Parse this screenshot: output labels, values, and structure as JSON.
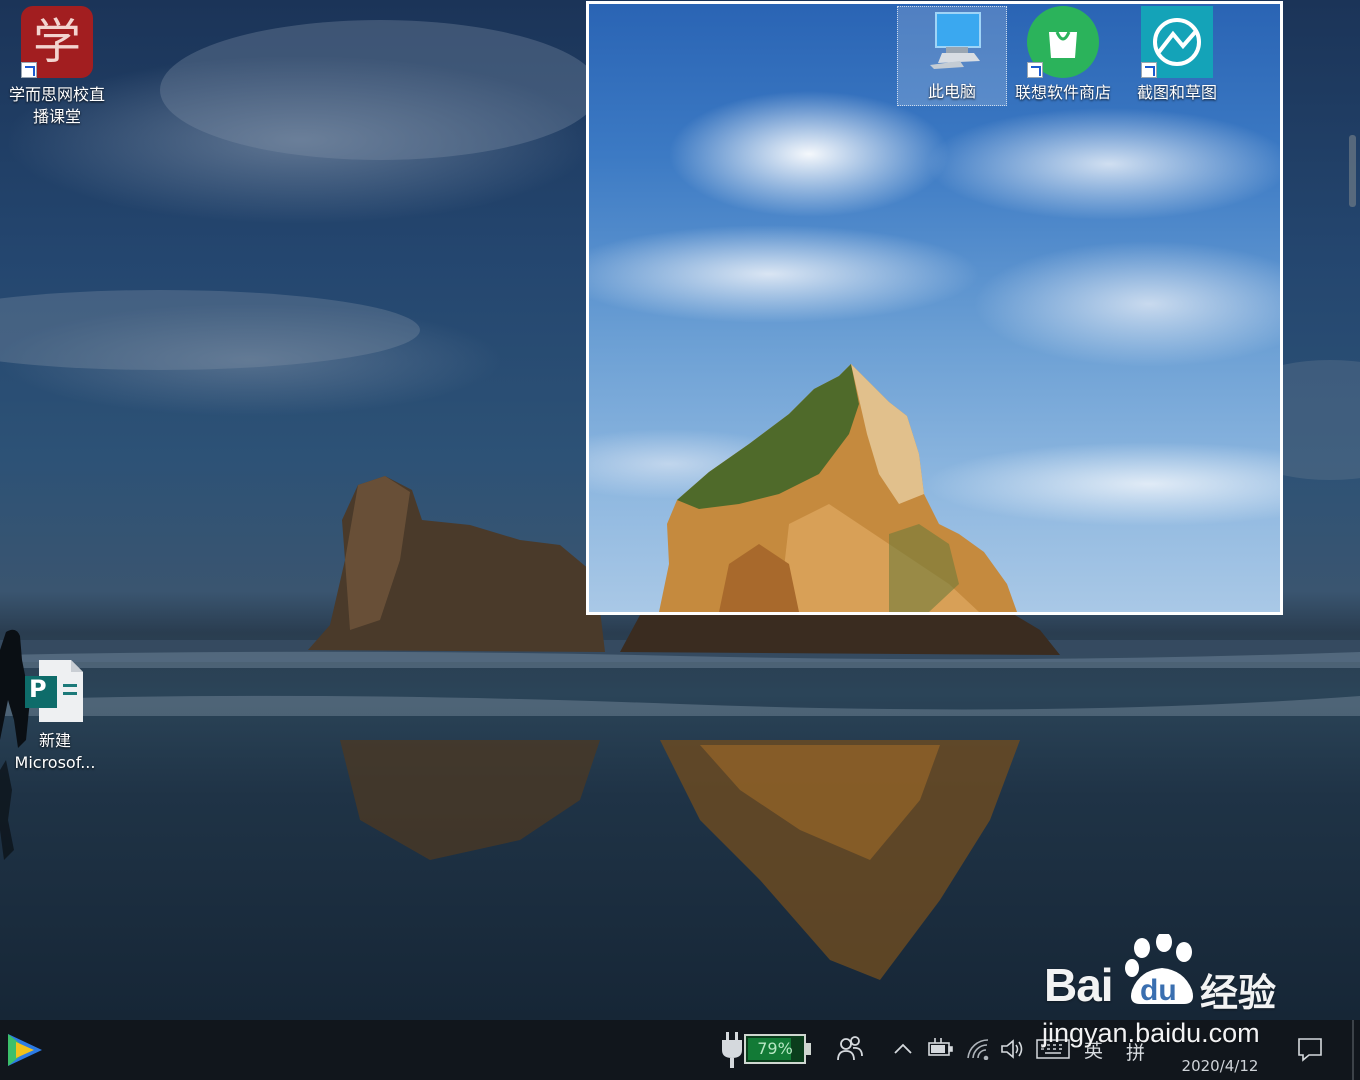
{
  "desktop": {
    "icons": [
      {
        "name": "xueersi",
        "label_line1": "学而思网校直",
        "label_line2": "播课堂",
        "glyph_char": "学",
        "icon": "xueersi-app-icon"
      },
      {
        "name": "this-pc",
        "label": "此电脑",
        "icon": "computer-icon"
      },
      {
        "name": "lenovo-store",
        "label": "联想软件商店",
        "icon": "shopping-bag-icon"
      },
      {
        "name": "snip-sketch",
        "label": "截图和草图",
        "icon": "snip-sketch-icon"
      },
      {
        "name": "publisher-doc",
        "label_line1": "新建",
        "label_line2": "Microsof...",
        "glyph_char": "P",
        "icon": "publisher-file-icon"
      }
    ],
    "selection_color": "#ffffff"
  },
  "taskbar": {
    "battery_percent": "79%",
    "battery_level": 0.79,
    "input_lang": "英",
    "ime": "拼",
    "date": "2020/4/12",
    "icons": [
      "play-triangle-icon",
      "power-plug-icon",
      "people-icon",
      "chevron-up-icon",
      "battery-tray-icon",
      "wifi-icon",
      "volume-icon",
      "keyboard-icon",
      "notification-icon"
    ]
  },
  "watermark": {
    "brand_latin": "Bai",
    "brand_du": "du",
    "brand_cn": "经验",
    "url": "jingyan.baidu.com"
  }
}
